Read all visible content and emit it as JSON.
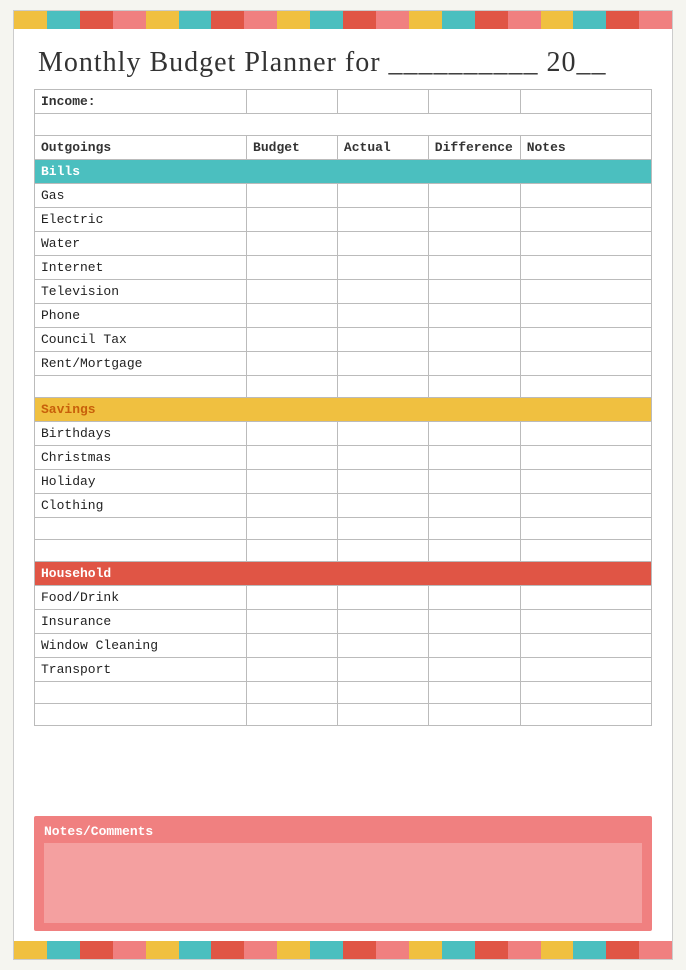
{
  "topBar": {
    "segments": [
      "yellow",
      "teal",
      "red",
      "pink",
      "yellow",
      "teal",
      "red",
      "pink",
      "yellow",
      "teal",
      "red",
      "pink",
      "yellow",
      "teal",
      "red",
      "pink",
      "yellow",
      "teal",
      "red",
      "pink"
    ]
  },
  "title": "Monthly Budget Planner for __________ 20__",
  "table": {
    "incomeLabel": "Income:",
    "headers": {
      "outgoings": "Outgoings",
      "budget": "Budget",
      "actual": "Actual",
      "difference": "Difference",
      "notes": "Notes"
    },
    "sections": [
      {
        "type": "section-header-teal",
        "label": "Bills"
      },
      {
        "type": "data",
        "label": "Gas"
      },
      {
        "type": "data",
        "label": "Electric"
      },
      {
        "type": "data",
        "label": "Water"
      },
      {
        "type": "data",
        "label": "Internet"
      },
      {
        "type": "data",
        "label": "Television"
      },
      {
        "type": "data",
        "label": "Phone"
      },
      {
        "type": "data",
        "label": "Council Tax"
      },
      {
        "type": "data",
        "label": "Rent/Mortgage"
      },
      {
        "type": "empty"
      },
      {
        "type": "section-header-yellow",
        "label": "Savings"
      },
      {
        "type": "data",
        "label": "Birthdays"
      },
      {
        "type": "data",
        "label": "Christmas"
      },
      {
        "type": "data",
        "label": "Holiday"
      },
      {
        "type": "data",
        "label": "Clothing"
      },
      {
        "type": "empty"
      },
      {
        "type": "empty"
      },
      {
        "type": "section-header-red",
        "label": "Household"
      },
      {
        "type": "data",
        "label": "Food/Drink"
      },
      {
        "type": "data",
        "label": "Insurance"
      },
      {
        "type": "data",
        "label": "Window Cleaning"
      },
      {
        "type": "data",
        "label": "Transport"
      },
      {
        "type": "empty"
      },
      {
        "type": "empty"
      }
    ]
  },
  "notesSection": {
    "label": "Notes/Comments"
  },
  "colors": {
    "teal": "#4bbfbf",
    "yellow": "#f0c040",
    "red": "#e05545",
    "pink": "#f08080",
    "lightpink": "#f4a0a0"
  },
  "bottomBar": {
    "segments": [
      "yellow",
      "teal",
      "red",
      "pink",
      "yellow",
      "teal",
      "red",
      "pink",
      "yellow",
      "teal",
      "red",
      "pink",
      "yellow",
      "teal",
      "red",
      "pink",
      "yellow",
      "teal",
      "red",
      "pink"
    ]
  }
}
